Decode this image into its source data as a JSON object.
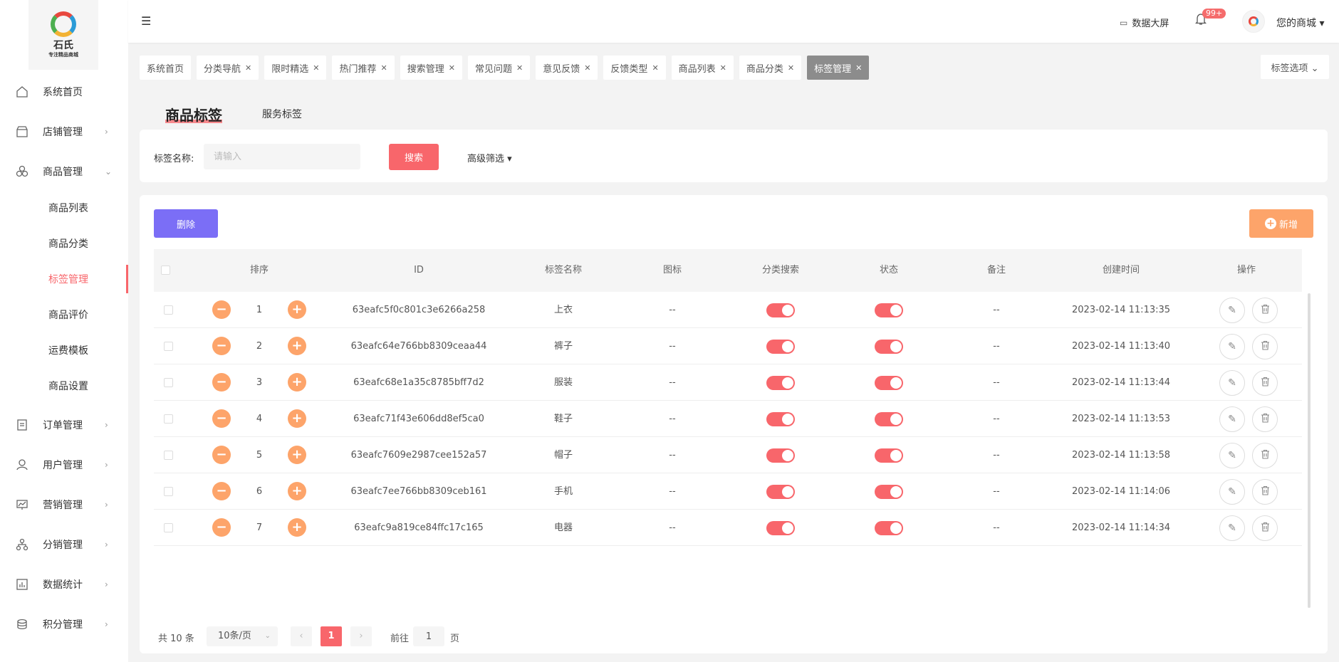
{
  "colors": {
    "accent": "#f8666b",
    "purple": "#7b6ef6",
    "orange": "#fda46a"
  },
  "logo": {
    "name": "石氏",
    "subtitle": "专注精品商城"
  },
  "sidebar": {
    "items": [
      {
        "label": "系统首页",
        "icon": "home-icon"
      },
      {
        "label": "店铺管理",
        "icon": "store-icon"
      },
      {
        "label": "商品管理",
        "icon": "goods-icon",
        "expanded": true
      },
      {
        "label": "订单管理",
        "icon": "order-icon"
      },
      {
        "label": "用户管理",
        "icon": "user-icon"
      },
      {
        "label": "营销管理",
        "icon": "marketing-icon"
      },
      {
        "label": "分销管理",
        "icon": "distribution-icon"
      },
      {
        "label": "数据统计",
        "icon": "chart-icon"
      },
      {
        "label": "积分管理",
        "icon": "points-icon"
      }
    ],
    "sub_items": [
      {
        "label": "商品列表"
      },
      {
        "label": "商品分类"
      },
      {
        "label": "标签管理",
        "active": true
      },
      {
        "label": "商品评价"
      },
      {
        "label": "运费模板"
      },
      {
        "label": "商品设置"
      }
    ]
  },
  "header": {
    "screen_label": "数据大屏",
    "badge": "99+",
    "shop_label": "您的商城 ▾"
  },
  "tags": {
    "items": [
      {
        "label": "系统首页",
        "closable": false
      },
      {
        "label": "分类导航",
        "closable": true
      },
      {
        "label": "限时精选",
        "closable": true
      },
      {
        "label": "热门推荐",
        "closable": true
      },
      {
        "label": "搜索管理",
        "closable": true
      },
      {
        "label": "常见问题",
        "closable": true
      },
      {
        "label": "意见反馈",
        "closable": true
      },
      {
        "label": "反馈类型",
        "closable": true
      },
      {
        "label": "商品列表",
        "closable": true
      },
      {
        "label": "商品分类",
        "closable": true
      },
      {
        "label": "标签管理",
        "closable": true,
        "active": true
      }
    ],
    "options_label": "标签选项 ⌄"
  },
  "page_tabs": {
    "main": "商品标签",
    "sub": "服务标签"
  },
  "search": {
    "label": "标签名称:",
    "placeholder": "请输入",
    "value": "",
    "button": "搜索",
    "advanced": "高级筛选 ▾"
  },
  "toolbar": {
    "delete": "删除",
    "add": "新增"
  },
  "table": {
    "columns": [
      "排序",
      "ID",
      "标签名称",
      "图标",
      "分类搜索",
      "状态",
      "备注",
      "创建时间",
      "操作"
    ],
    "rows": [
      {
        "sort": "1",
        "id": "63eafc5f0c801c3e6266a258",
        "name": "上衣",
        "icon": "--",
        "category_search": true,
        "status": true,
        "remark": "--",
        "created": "2023-02-14 11:13:35"
      },
      {
        "sort": "2",
        "id": "63eafc64e766bb8309ceaa44",
        "name": "裤子",
        "icon": "--",
        "category_search": true,
        "status": true,
        "remark": "--",
        "created": "2023-02-14 11:13:40"
      },
      {
        "sort": "3",
        "id": "63eafc68e1a35c8785bff7d2",
        "name": "服装",
        "icon": "--",
        "category_search": true,
        "status": true,
        "remark": "--",
        "created": "2023-02-14 11:13:44"
      },
      {
        "sort": "4",
        "id": "63eafc71f43e606dd8ef5ca0",
        "name": "鞋子",
        "icon": "--",
        "category_search": true,
        "status": true,
        "remark": "--",
        "created": "2023-02-14 11:13:53"
      },
      {
        "sort": "5",
        "id": "63eafc7609e2987cee152a57",
        "name": "帽子",
        "icon": "--",
        "category_search": true,
        "status": true,
        "remark": "--",
        "created": "2023-02-14 11:13:58"
      },
      {
        "sort": "6",
        "id": "63eafc7ee766bb8309ceb161",
        "name": "手机",
        "icon": "--",
        "category_search": true,
        "status": true,
        "remark": "--",
        "created": "2023-02-14 11:14:06"
      },
      {
        "sort": "7",
        "id": "63eafc9a819ce84ffc17c165",
        "name": "电器",
        "icon": "--",
        "category_search": true,
        "status": true,
        "remark": "--",
        "created": "2023-02-14 11:14:34"
      }
    ]
  },
  "pagination": {
    "total": "共 10 条",
    "page_size": "10条/页",
    "current": "1",
    "goto_label": "前往",
    "goto_value": "1",
    "unit": "页"
  }
}
